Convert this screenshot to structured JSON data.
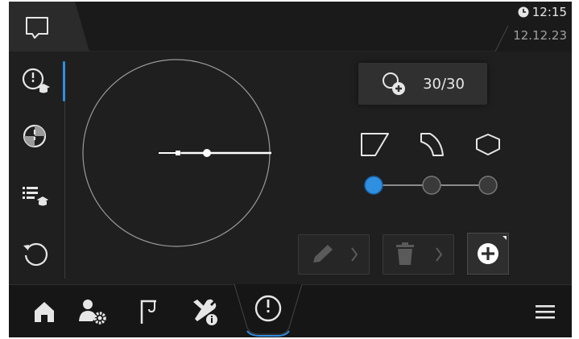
{
  "header": {
    "time": "12:15",
    "date": "12.12.23",
    "message_icon": "chat-bubble-icon",
    "clock_icon": "clock-icon"
  },
  "sidebar": {
    "items": [
      {
        "name": "circle-teach-item",
        "icon": "circle-teach-icon",
        "active": true
      },
      {
        "name": "circle-pattern-item",
        "icon": "circle-hatch-icon",
        "active": false
      },
      {
        "name": "list-teach-item",
        "icon": "list-teach-icon",
        "active": false
      },
      {
        "name": "reset-item",
        "icon": "rotate-ccw-icon",
        "active": false
      }
    ]
  },
  "main": {
    "radius": {
      "icon": "add-circle-icon",
      "value": "30/30"
    },
    "shapes": [
      {
        "name": "shape-corner",
        "icon": "corner-shape-icon"
      },
      {
        "name": "shape-arc",
        "icon": "arc-shape-icon"
      },
      {
        "name": "shape-hexagon",
        "icon": "hexagon-shape-icon"
      }
    ],
    "slider": {
      "positions": 3,
      "selected_index": 0
    },
    "actions": {
      "edit_icon": "pencil-icon",
      "delete_icon": "trash-icon",
      "add_icon": "plus-circle-icon",
      "chevron": "chevron-right-icon"
    }
  },
  "bottom_nav": {
    "items": [
      {
        "name": "home",
        "icon": "home-icon"
      },
      {
        "name": "user-settings",
        "icon": "user-gear-icon"
      },
      {
        "name": "crane",
        "icon": "crane-hook-icon"
      },
      {
        "name": "tools-info",
        "icon": "tools-info-icon"
      },
      {
        "name": "circle-mode",
        "icon": "circle-mode-icon",
        "active": true
      }
    ],
    "menu_icon": "hamburger-menu-icon"
  },
  "colors": {
    "accent": "#2f8fe0",
    "background": "#1f1f1f",
    "foreground": "#e8e8e8"
  }
}
